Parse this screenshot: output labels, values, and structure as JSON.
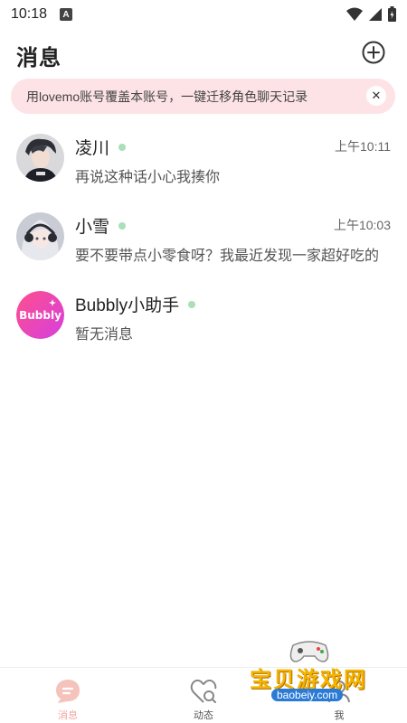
{
  "status_bar": {
    "time": "10:18",
    "a_label": "A"
  },
  "header": {
    "title": "消息"
  },
  "banner": {
    "text": "用lovemo账号覆盖本账号，一键迁移角色聊天记录",
    "close_symbol": "✕"
  },
  "chats": [
    {
      "name": "凌川",
      "time": "上午10:11",
      "preview": "再说这种话小心我揍你"
    },
    {
      "name": "小雪",
      "time": "上午10:03",
      "preview": "要不要带点小零食呀？我最近发现一家超好吃的"
    },
    {
      "name": "Bubbly小助手",
      "time": "",
      "preview": "暂无消息",
      "avatar_text": "Bubbly"
    }
  ],
  "tabs": [
    {
      "label": "消息"
    },
    {
      "label": "动态"
    },
    {
      "label": "我"
    }
  ],
  "watermark": {
    "text": "宝贝游戏网",
    "url": "baobeiy.com"
  },
  "colors": {
    "accent": "#f1a6a0",
    "banner_bg": "#fde3e6",
    "online_dot": "#a9e0b8"
  }
}
